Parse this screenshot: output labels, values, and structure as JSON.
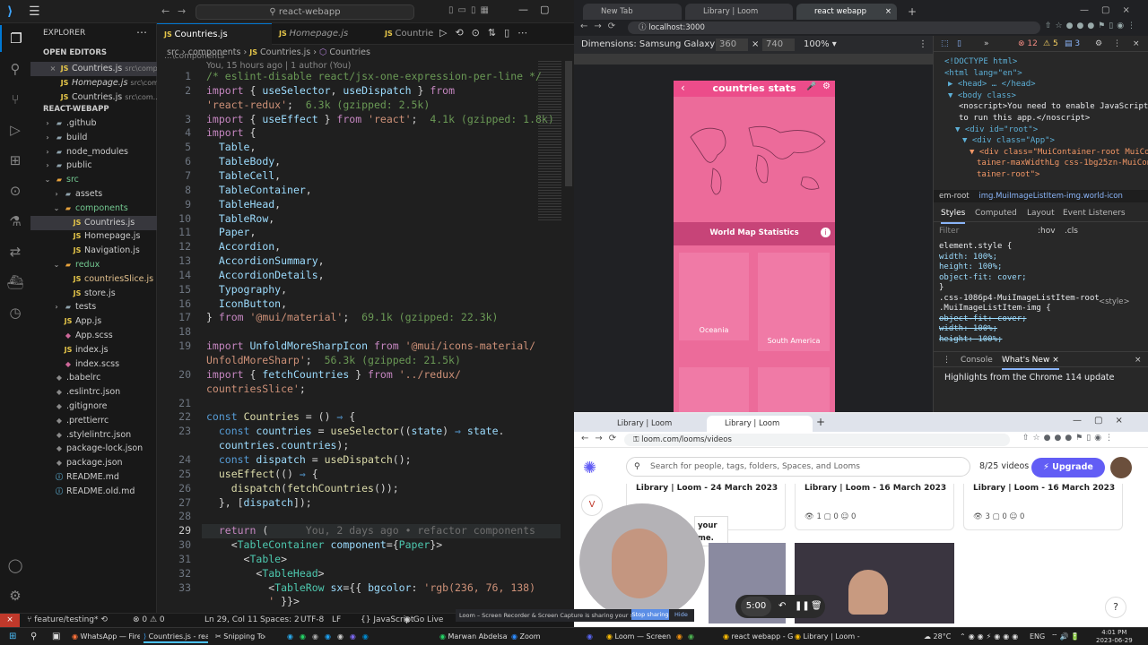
{
  "vscode": {
    "search_text": "react-webapp",
    "sidebar": {
      "header": "EXPLORER",
      "open_editors_label": "OPEN EDITORS",
      "open_editors": [
        {
          "name": "Countries.js",
          "path": "src\\comp...",
          "badge": "",
          "modified": false
        },
        {
          "name": "Homepage.js",
          "path": "src\\comp...",
          "badge": "",
          "modified": false
        },
        {
          "name": "Countries.js",
          "path": "src\\com...",
          "badge": "U",
          "modified": false
        }
      ],
      "project_label": "REACT-WEBAPP",
      "tree": [
        {
          "name": ".github",
          "type": "folder",
          "depth": 1
        },
        {
          "name": "build",
          "type": "folder",
          "depth": 1
        },
        {
          "name": "node_modules",
          "type": "folder",
          "depth": 1
        },
        {
          "name": "public",
          "type": "folder",
          "depth": 1
        },
        {
          "name": "src",
          "type": "folder-open",
          "depth": 1
        },
        {
          "name": "assets",
          "type": "folder",
          "depth": 2
        },
        {
          "name": "components",
          "type": "folder-open",
          "depth": 2
        },
        {
          "name": "Countries.js",
          "type": "js",
          "depth": 3
        },
        {
          "name": "Homepage.js",
          "type": "js",
          "depth": 3
        },
        {
          "name": "Navigation.js",
          "type": "js",
          "depth": 3
        },
        {
          "name": "redux",
          "type": "folder-open",
          "depth": 2
        },
        {
          "name": "countriesSlice.js",
          "type": "js",
          "depth": 3,
          "badge": "M"
        },
        {
          "name": "store.js",
          "type": "js",
          "depth": 3
        },
        {
          "name": "tests",
          "type": "folder",
          "depth": 2
        },
        {
          "name": "App.js",
          "type": "js",
          "depth": 2
        },
        {
          "name": "App.scss",
          "type": "scss",
          "depth": 2
        },
        {
          "name": "index.js",
          "type": "js",
          "depth": 2
        },
        {
          "name": "index.scss",
          "type": "scss",
          "depth": 2
        },
        {
          "name": ".babelrc",
          "type": "cfg",
          "depth": 1
        },
        {
          "name": ".eslintrc.json",
          "type": "cfg",
          "depth": 1
        },
        {
          "name": ".gitignore",
          "type": "cfg",
          "depth": 1
        },
        {
          "name": ".prettierrc",
          "type": "cfg",
          "depth": 1
        },
        {
          "name": ".stylelintrc.json",
          "type": "cfg",
          "depth": 1
        },
        {
          "name": "package-lock.json",
          "type": "cfg",
          "depth": 1
        },
        {
          "name": "package.json",
          "type": "cfg",
          "depth": 1
        },
        {
          "name": "README.md",
          "type": "md",
          "depth": 1
        },
        {
          "name": "README.old.md",
          "type": "md",
          "depth": 1
        }
      ]
    },
    "tabs": [
      {
        "label": "Countries.js",
        "extra": "...\\components",
        "active": true
      },
      {
        "label": "Homepage.js",
        "extra": "",
        "active": false
      },
      {
        "label": "Countrie",
        "extra": "",
        "active": false
      }
    ],
    "breadcrumb": [
      "src",
      "components",
      "Countries.js",
      "Countries"
    ],
    "blame": "You, 15 hours ago | 1 author (You)",
    "inline_blame": "You, 2 days ago • refactor components",
    "lines": [
      {
        "n": "1",
        "html": "<span class='c'>/* eslint-disable react/jsx-one-expression-per-line */</span>"
      },
      {
        "n": "2",
        "html": "<span class='k'>import</span> { <span class='v'>useSelector</span>, <span class='v'>useDispatch</span> } <span class='k'>from</span>"
      },
      {
        "n": "",
        "html": "<span class='s'>'react-redux'</span>;  <span class='g'>6.3k (gzipped: 2.5k)</span>"
      },
      {
        "n": "3",
        "html": "<span class='k'>import</span> { <span class='v'>useEffect</span> } <span class='k'>from</span> <span class='s'>'react'</span>;  <span class='g'>4.1k (gzipped: 1.8k)</span>"
      },
      {
        "n": "4",
        "html": "<span class='k'>import</span> {"
      },
      {
        "n": "5",
        "html": "  <span class='v'>Table</span>,"
      },
      {
        "n": "6",
        "html": "  <span class='v'>TableBody</span>,"
      },
      {
        "n": "7",
        "html": "  <span class='v'>TableCell</span>,"
      },
      {
        "n": "8",
        "html": "  <span class='v'>TableContainer</span>,"
      },
      {
        "n": "9",
        "html": "  <span class='v'>TableHead</span>,"
      },
      {
        "n": "10",
        "html": "  <span class='v'>TableRow</span>,"
      },
      {
        "n": "11",
        "html": "  <span class='v'>Paper</span>,"
      },
      {
        "n": "12",
        "html": "  <span class='v'>Accordion</span>,"
      },
      {
        "n": "13",
        "html": "  <span class='v'>AccordionSummary</span>,"
      },
      {
        "n": "14",
        "html": "  <span class='v'>AccordionDetails</span>,"
      },
      {
        "n": "15",
        "html": "  <span class='v'>Typography</span>,"
      },
      {
        "n": "16",
        "html": "  <span class='v'>IconButton</span>,"
      },
      {
        "n": "17",
        "html": "} <span class='k'>from</span> <span class='s'>'@mui/material'</span>;  <span class='g'>69.1k (gzipped: 22.3k)</span>"
      },
      {
        "n": "18",
        "html": ""
      },
      {
        "n": "19",
        "html": "<span class='k'>import</span> <span class='v'>UnfoldMoreSharpIcon</span> <span class='k'>from</span> <span class='s'>'@mui/icons-material/</span>"
      },
      {
        "n": "",
        "html": "<span class='s'>UnfoldMoreSharp'</span>;  <span class='g'>56.3k (gzipped: 21.5k)</span>"
      },
      {
        "n": "20",
        "html": "<span class='k'>import</span> { <span class='v'>fetchCountries</span> } <span class='k'>from</span> <span class='s'>'../redux/</span>"
      },
      {
        "n": "",
        "html": "<span class='s'>countriesSlice'</span>;"
      },
      {
        "n": "21",
        "html": ""
      },
      {
        "n": "22",
        "html": "<span class='k' style='color:#569cd6'>const</span> <span class='f'>Countries</span> = () <span class='k' style='color:#569cd6'>⇒</span> {"
      },
      {
        "n": "23",
        "html": "  <span class='k' style='color:#569cd6'>const</span> <span class='v'>countries</span> = <span class='f'>useSelector</span>((<span class='v'>state</span>) <span class='k' style='color:#569cd6'>⇒</span> <span class='v'>state</span>."
      },
      {
        "n": "",
        "html": "  <span class='v'>countries</span>.<span class='v'>countries</span>);"
      },
      {
        "n": "24",
        "html": "  <span class='k' style='color:#569cd6'>const</span> <span class='v'>dispatch</span> = <span class='f'>useDispatch</span>();"
      },
      {
        "n": "25",
        "html": "  <span class='f'>useEffect</span>(() <span class='k' style='color:#569cd6'>⇒</span> {"
      },
      {
        "n": "26",
        "html": "    <span class='f'>dispatch</span>(<span class='f'>fetchCountries</span>());"
      },
      {
        "n": "27",
        "html": "  }, [<span class='v'>dispatch</span>]);"
      },
      {
        "n": "28",
        "html": ""
      },
      {
        "n": "29",
        "html": "  <span class='k'>return</span> (      <span style='color:#6e6e6e'>You, 2 days ago • refactor components</span>"
      },
      {
        "n": "30",
        "html": "    &lt;<span class='t'>TableContainer</span> <span class='v'>component</span>={<span class='t'>Paper</span>}&gt;"
      },
      {
        "n": "31",
        "html": "      &lt;<span class='t'>Table</span>&gt;"
      },
      {
        "n": "32",
        "html": "        &lt;<span class='t'>TableHead</span>&gt;"
      },
      {
        "n": "33",
        "html": "          &lt;<span class='t'>TableRow</span> <span class='v'>sx</span>={{ <span class='v'>bgcolor</span>: <span class='s'>'rgb(236, 76, 138)</span>"
      },
      {
        "n": "",
        "html": "          <span class='s'>'</span> }}&gt;"
      }
    ],
    "status": {
      "branch": "feature/testing*",
      "problems": "⊗ 0 ⚠ 0",
      "position": "Ln 29, Col 11",
      "spaces": "Spaces: 2",
      "encoding": "UTF-8",
      "eol": "LF",
      "language": "JavaScript",
      "golive": "Go Live"
    }
  },
  "chrome_top": {
    "tabs": [
      "New Tab",
      "Library | Loom",
      "react webapp"
    ],
    "url": "localhost:3000",
    "device_label": "Dimensions: Samsung Galaxy ...",
    "width": "360",
    "height": "740",
    "zoom": "100%",
    "app": {
      "title": "countries stats",
      "section_title": "World Map Statistics",
      "cards": [
        "Oceania",
        "South America"
      ]
    },
    "devtools": {
      "errors": "12",
      "warnings": "5",
      "info": "3",
      "dom_lines": [
        "<!DOCTYPE html>",
        "<html lang=\"en\">",
        "▶ <head> … </head>",
        "▼ <body class>",
        "<noscript>You need to enable JavaScript",
        "to run this app.</noscript>",
        "▼ <div id=\"root\">",
        "▼ <div class=\"App\">",
        "▼ <div class=\"MuiContainer-root MuiCon",
        "tainer-maxWidthLg css-1bg25zn-MuiCon",
        "tainer-root\">"
      ],
      "crumb": [
        "em-root",
        "img.MuiImageListItem-img.world-icon"
      ],
      "style_tabs": [
        "Styles",
        "Computed",
        "Layout",
        "Event Listeners"
      ],
      "filter_placeholder": "Filter",
      "hov": ":hov",
      "cls": ".cls",
      "css_lines": [
        "element.style {",
        "  width: 100%;",
        "  height: 100%;",
        "  object-fit: cover;",
        "}",
        ".css-1086p4-MuiImageListItem-root",
        ".MuiImageListItem-img {",
        "  object-fit: cover;",
        "  width: 100%;",
        "  height: 100%;"
      ],
      "style_src": "<style>",
      "drawer_tabs": [
        "Console",
        "What's New"
      ],
      "whatsnew": "Highlights from the Chrome 114 update"
    }
  },
  "chrome_bottom": {
    "tabs": [
      "Library | Loom",
      "Library | Loom"
    ],
    "url": "loom.com/looms/videos",
    "search_placeholder": "Search for people, tags, folders, Spaces, and Looms",
    "video_count": "8/25 videos",
    "upgrade": "Upgrade",
    "videos": [
      {
        "title": "Library | Loom - 24 March 2023",
        "views": "",
        "comments": "",
        "reactions": ""
      },
      {
        "title": "Library | Loom - 16 March 2023",
        "views": "1",
        "comments": "0",
        "reactions": "0"
      },
      {
        "title": "Library | Loom - 16 March 2023",
        "views": "3",
        "comments": "0",
        "reactions": "0"
      }
    ],
    "overlay_text": [
      "your",
      "me."
    ],
    "sharing_notice": "Loom – Screen Recorder & Screen Capture is sharing your screen.",
    "stop_sharing": "Stop sharing",
    "hide": "Hide",
    "timer": "5:00",
    "help": "?"
  },
  "taskbar": {
    "items": [
      "WhatsApp — Firefo...",
      "Countries.js - react...",
      "Snipping Tool",
      "Marwan Abdelsatta...",
      "Zoom",
      "Loom — Screen Rec...",
      "react webapp - Go...",
      "Library | Loom - Go..."
    ],
    "temp": "28°C",
    "lang": "ENG",
    "time": "4:01 PM",
    "date": "2023-06-29"
  }
}
